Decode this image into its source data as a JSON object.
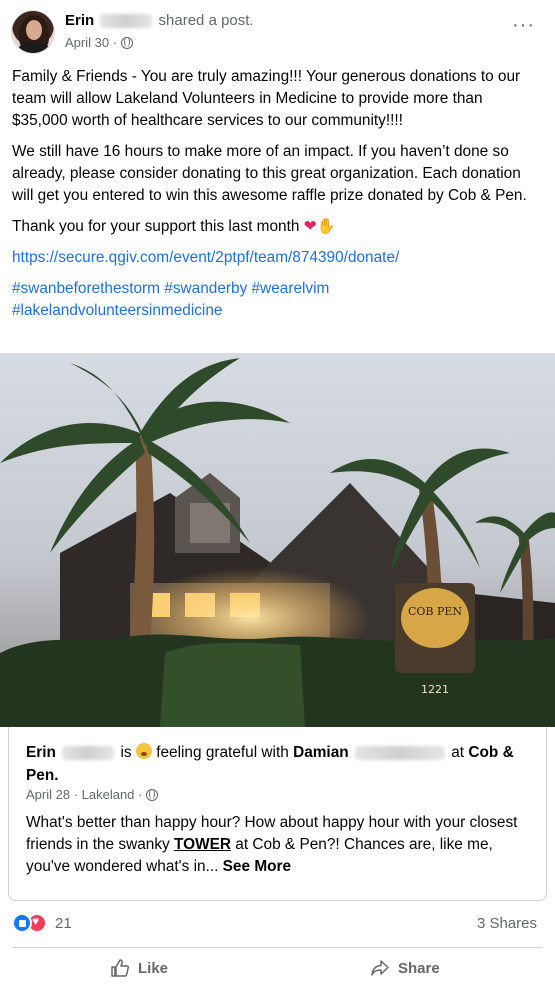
{
  "post": {
    "author": "Erin",
    "action": "shared a post.",
    "date": "April 30 ·",
    "text": {
      "p1": "Family & Friends - You are truly amazing!!! Your generous donations to our team will allow Lakeland Volunteers in Medicine to provide more than $35,000 worth of healthcare services to our community!!!!",
      "p2": "We still have 16 hours to make more of an impact. If you haven’t done so already, please consider donating to this great organization. Each donation will get you entered to win this awesome raffle prize donated by Cob & Pen.",
      "p3": "Thank you for your support this last month",
      "link": "https://secure.qgiv.com/event/2ptpf/team/874390/donate/",
      "hashtags1": "#swanbeforethestorm #swanderby #wearelvim",
      "hashtags2": "#lakelandvolunteersinmedicine"
    }
  },
  "photo": {
    "sign_text": "COB PEN",
    "address": "1221"
  },
  "shared": {
    "author": "Erin",
    "is": "is",
    "feeling": "feeling grateful with",
    "tagged": "Damian",
    "at": "at",
    "place": "Cob & Pen.",
    "date": "April 28 · Lakeland ·",
    "text_before": "What's better than happy hour? How about happy hour with your closest friends in the swanky ",
    "text_underline": "TOWER",
    "text_after": " at Cob & Pen?! Chances are, like me, you've wondered what's in...",
    "see_more": "See More"
  },
  "footer": {
    "reaction_count": "21",
    "shares": "3 Shares",
    "like_label": "Like",
    "share_label": "Share"
  }
}
